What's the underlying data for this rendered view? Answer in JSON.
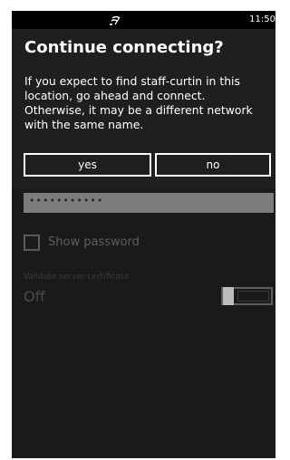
{
  "status_bar": {
    "time": "11:50",
    "signal_icon": "wifi-signal-icon"
  },
  "dialog": {
    "title": "Continue connecting?",
    "message": "If you expect to find staff-curtin in this location, go ahead and connect. Otherwise, it may be a different network with the same name.",
    "yes_label": "yes",
    "no_label": "no"
  },
  "settings": {
    "password_value": "•••••••••••",
    "show_password_label": "Show password",
    "show_password_checked": false,
    "validate_label": "Validate server certificate",
    "validate_value": "Off",
    "validate_on": false
  }
}
